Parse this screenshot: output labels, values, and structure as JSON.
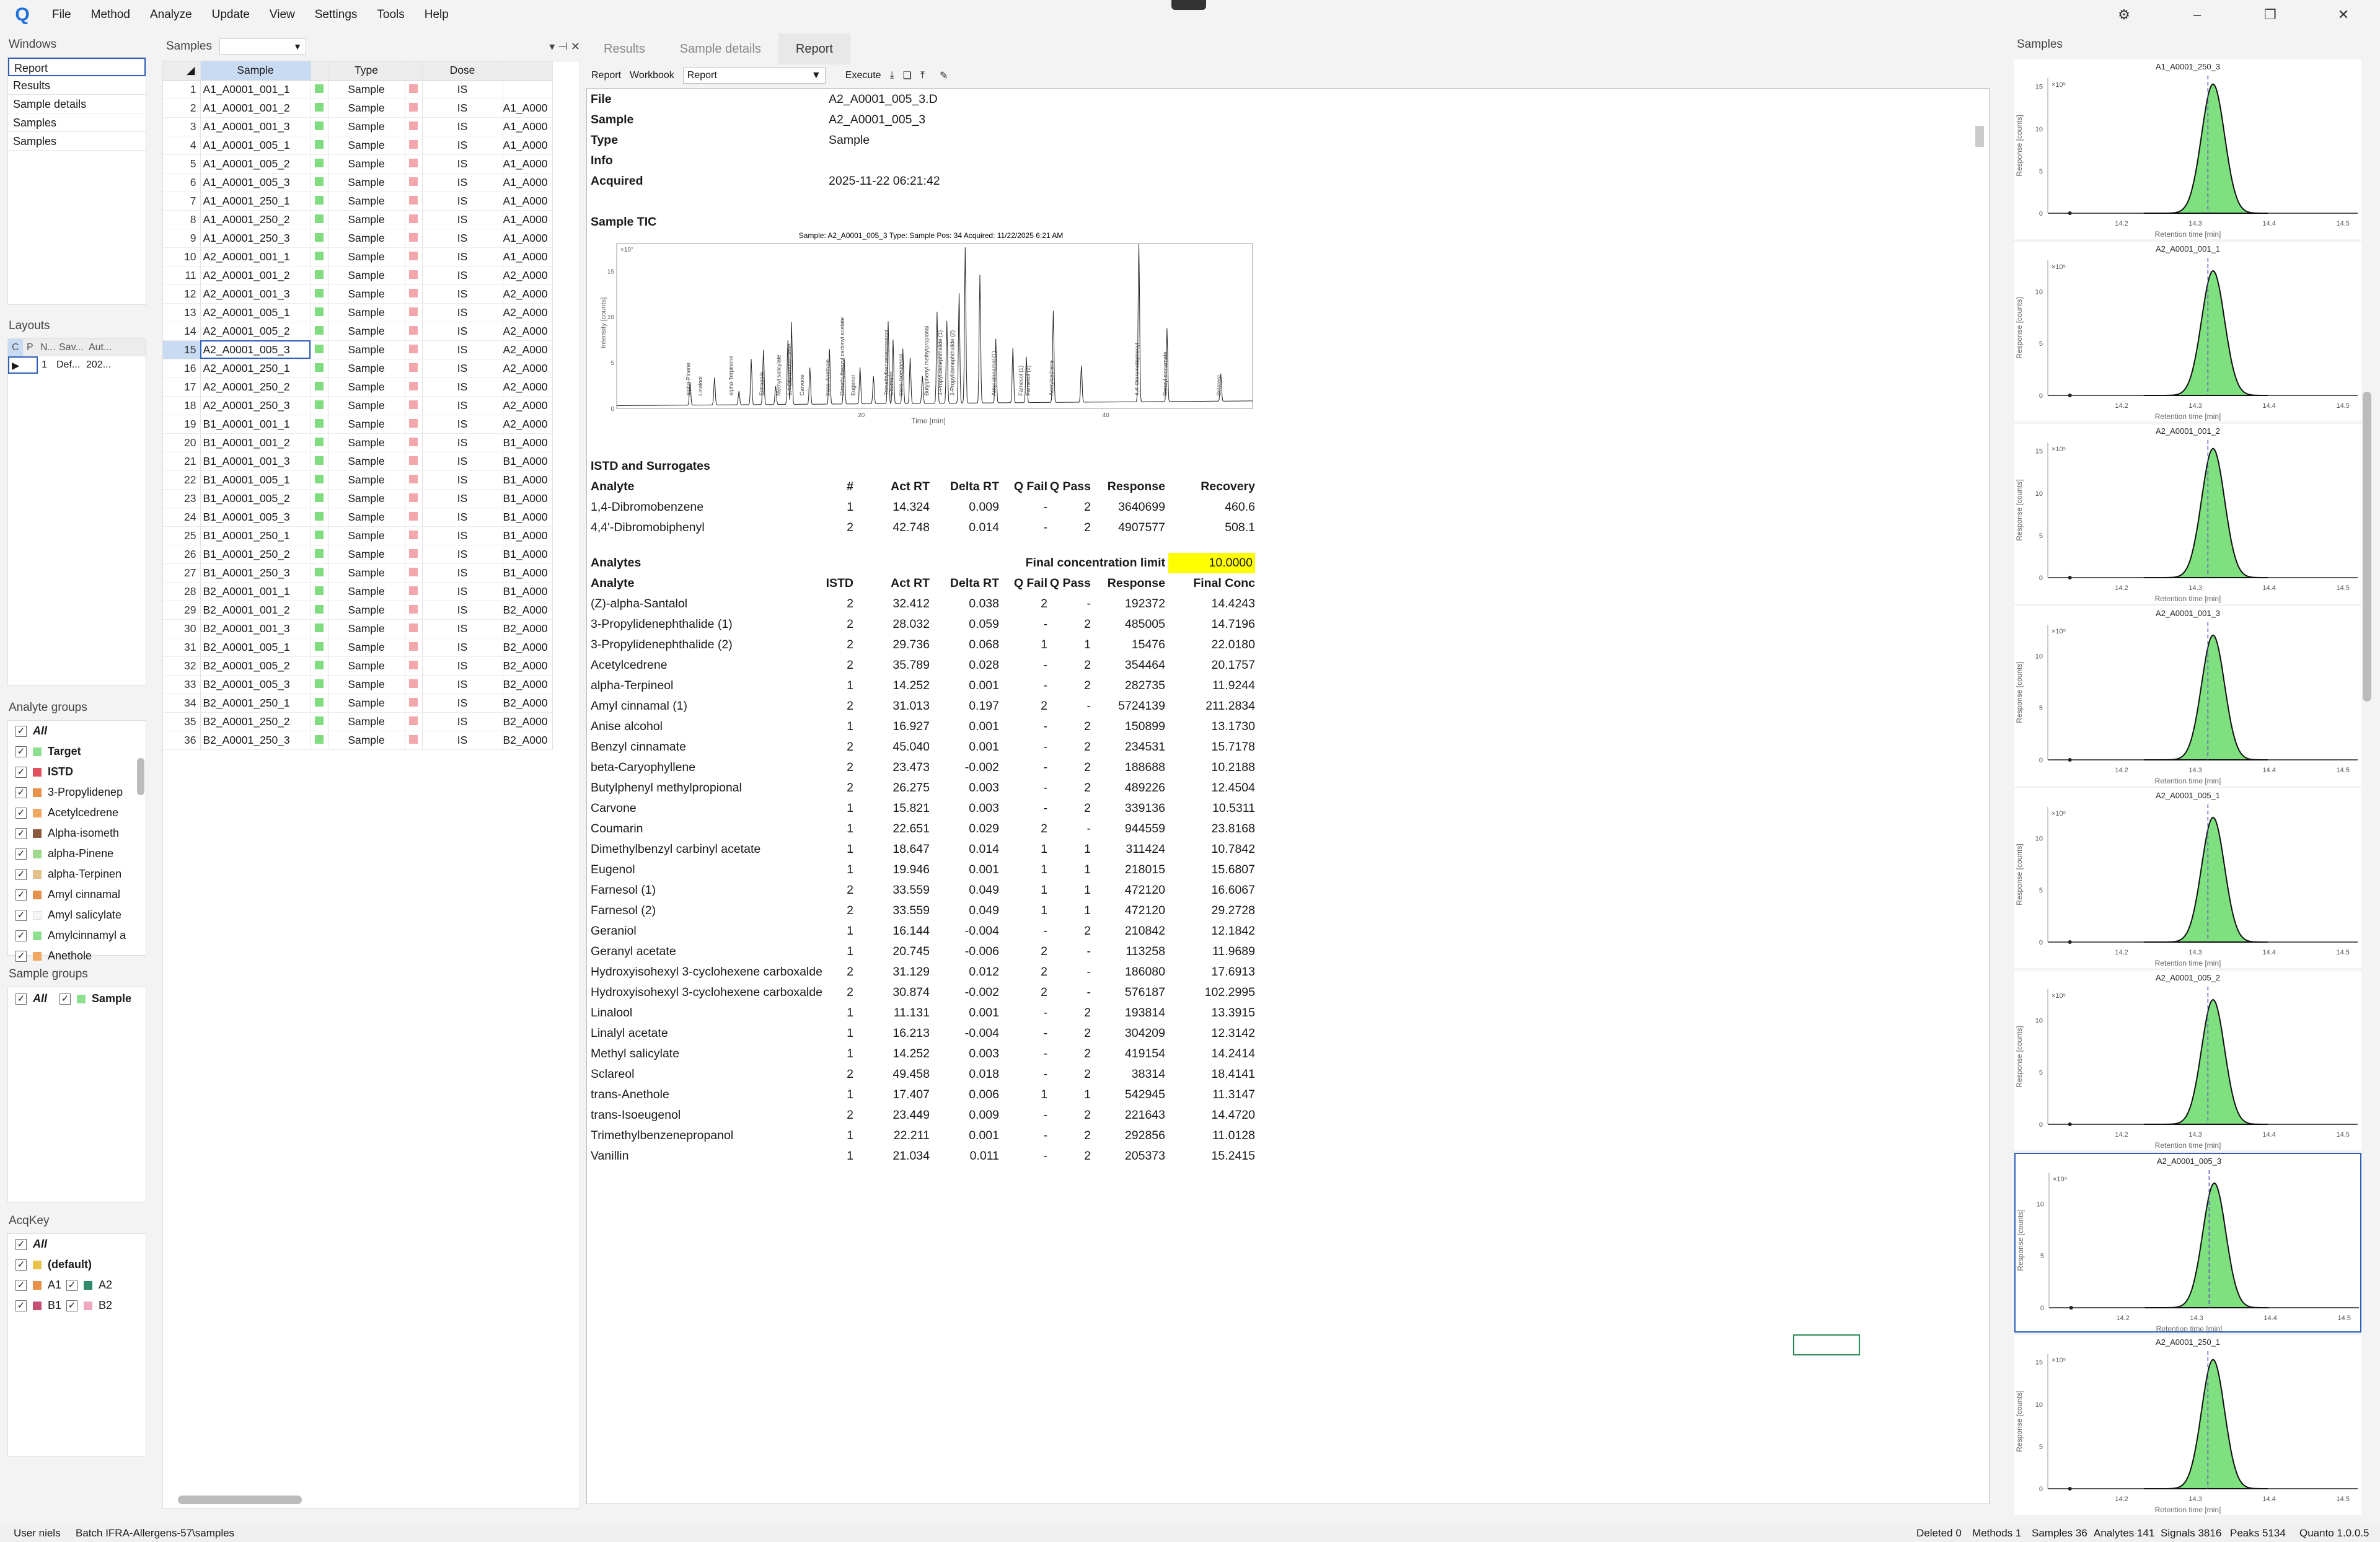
{
  "menu": [
    "File",
    "Method",
    "Analyze",
    "Update",
    "View",
    "Settings",
    "Tools",
    "Help"
  ],
  "windows": {
    "title": "Windows",
    "items": [
      "Report",
      "Results",
      "Sample details",
      "Samples",
      "Samples"
    ]
  },
  "layouts": {
    "title": "Layouts",
    "headers": [
      "C",
      "P",
      "N...",
      "Sav...",
      "Aut..."
    ],
    "row": [
      "1",
      "Def...",
      "202..."
    ]
  },
  "analyte_groups": {
    "title": "Analyte groups",
    "items": [
      {
        "label": "All",
        "color": "",
        "bold": true
      },
      {
        "label": "Target",
        "color": "#8de08d",
        "bold": true
      },
      {
        "label": "ISTD",
        "color": "#e0525d",
        "bold": true
      },
      {
        "label": "3-Propylidenep",
        "color": "#e8914a"
      },
      {
        "label": "Acetylcedrene",
        "color": "#f0a860"
      },
      {
        "label": "Alpha-isometh",
        "color": "#8b5a3c"
      },
      {
        "label": "alpha-Pinene",
        "color": "#9ed88f"
      },
      {
        "label": "alpha-Terpinen",
        "color": "#e3c18a"
      },
      {
        "label": "Amyl cinnamal",
        "color": "#e8914a"
      },
      {
        "label": "Amyl salicylate",
        "color": "#f5f5f5"
      },
      {
        "label": "Amylcinnamyl a",
        "color": "#8de08d"
      },
      {
        "label": "Anethole",
        "color": "#f0a860"
      }
    ]
  },
  "sample_groups": {
    "title": "Sample groups",
    "all": "All",
    "sample": "Sample"
  },
  "acqkey": {
    "title": "AcqKey",
    "all": "All",
    "default": "(default)",
    "a1": "A1",
    "a2": "A2",
    "b1": "B1",
    "b2": "B2"
  },
  "samples_panel": {
    "title": "Samples",
    "headers": [
      "Sample",
      "Type",
      "Dose"
    ],
    "rows": [
      {
        "n": "1",
        "name": "A1_A0001_001_1",
        "type": "Sample",
        "dose": "IS",
        "extra": ""
      },
      {
        "n": "2",
        "name": "A1_A0001_001_2",
        "type": "Sample",
        "dose": "IS",
        "extra": "A1_A000"
      },
      {
        "n": "3",
        "name": "A1_A0001_001_3",
        "type": "Sample",
        "dose": "IS",
        "extra": "A1_A000"
      },
      {
        "n": "4",
        "name": "A1_A0001_005_1",
        "type": "Sample",
        "dose": "IS",
        "extra": "A1_A000"
      },
      {
        "n": "5",
        "name": "A1_A0001_005_2",
        "type": "Sample",
        "dose": "IS",
        "extra": "A1_A000"
      },
      {
        "n": "6",
        "name": "A1_A0001_005_3",
        "type": "Sample",
        "dose": "IS",
        "extra": "A1_A000"
      },
      {
        "n": "7",
        "name": "A1_A0001_250_1",
        "type": "Sample",
        "dose": "IS",
        "extra": "A1_A000"
      },
      {
        "n": "8",
        "name": "A1_A0001_250_2",
        "type": "Sample",
        "dose": "IS",
        "extra": "A1_A000"
      },
      {
        "n": "9",
        "name": "A1_A0001_250_3",
        "type": "Sample",
        "dose": "IS",
        "extra": "A1_A000"
      },
      {
        "n": "10",
        "name": "A2_A0001_001_1",
        "type": "Sample",
        "dose": "IS",
        "extra": "A1_A000"
      },
      {
        "n": "11",
        "name": "A2_A0001_001_2",
        "type": "Sample",
        "dose": "IS",
        "extra": "A2_A000"
      },
      {
        "n": "12",
        "name": "A2_A0001_001_3",
        "type": "Sample",
        "dose": "IS",
        "extra": "A2_A000"
      },
      {
        "n": "13",
        "name": "A2_A0001_005_1",
        "type": "Sample",
        "dose": "IS",
        "extra": "A2_A000"
      },
      {
        "n": "14",
        "name": "A2_A0001_005_2",
        "type": "Sample",
        "dose": "IS",
        "extra": "A2_A000"
      },
      {
        "n": "15",
        "name": "A2_A0001_005_3",
        "type": "Sample",
        "dose": "IS",
        "extra": "A2_A000"
      },
      {
        "n": "16",
        "name": "A2_A0001_250_1",
        "type": "Sample",
        "dose": "IS",
        "extra": "A2_A000"
      },
      {
        "n": "17",
        "name": "A2_A0001_250_2",
        "type": "Sample",
        "dose": "IS",
        "extra": "A2_A000"
      },
      {
        "n": "18",
        "name": "A2_A0001_250_3",
        "type": "Sample",
        "dose": "IS",
        "extra": "A2_A000"
      },
      {
        "n": "19",
        "name": "B1_A0001_001_1",
        "type": "Sample",
        "dose": "IS",
        "extra": "A2_A000"
      },
      {
        "n": "20",
        "name": "B1_A0001_001_2",
        "type": "Sample",
        "dose": "IS",
        "extra": "B1_A000"
      },
      {
        "n": "21",
        "name": "B1_A0001_001_3",
        "type": "Sample",
        "dose": "IS",
        "extra": "B1_A000"
      },
      {
        "n": "22",
        "name": "B1_A0001_005_1",
        "type": "Sample",
        "dose": "IS",
        "extra": "B1_A000"
      },
      {
        "n": "23",
        "name": "B1_A0001_005_2",
        "type": "Sample",
        "dose": "IS",
        "extra": "B1_A000"
      },
      {
        "n": "24",
        "name": "B1_A0001_005_3",
        "type": "Sample",
        "dose": "IS",
        "extra": "B1_A000"
      },
      {
        "n": "25",
        "name": "B1_A0001_250_1",
        "type": "Sample",
        "dose": "IS",
        "extra": "B1_A000"
      },
      {
        "n": "26",
        "name": "B1_A0001_250_2",
        "type": "Sample",
        "dose": "IS",
        "extra": "B1_A000"
      },
      {
        "n": "27",
        "name": "B1_A0001_250_3",
        "type": "Sample",
        "dose": "IS",
        "extra": "B1_A000"
      },
      {
        "n": "28",
        "name": "B2_A0001_001_1",
        "type": "Sample",
        "dose": "IS",
        "extra": "B1_A000"
      },
      {
        "n": "29",
        "name": "B2_A0001_001_2",
        "type": "Sample",
        "dose": "IS",
        "extra": "B2_A000"
      },
      {
        "n": "30",
        "name": "B2_A0001_001_3",
        "type": "Sample",
        "dose": "IS",
        "extra": "B2_A000"
      },
      {
        "n": "31",
        "name": "B2_A0001_005_1",
        "type": "Sample",
        "dose": "IS",
        "extra": "B2_A000"
      },
      {
        "n": "32",
        "name": "B2_A0001_005_2",
        "type": "Sample",
        "dose": "IS",
        "extra": "B2_A000"
      },
      {
        "n": "33",
        "name": "B2_A0001_005_3",
        "type": "Sample",
        "dose": "IS",
        "extra": "B2_A000"
      },
      {
        "n": "34",
        "name": "B2_A0001_250_1",
        "type": "Sample",
        "dose": "IS",
        "extra": "B2_A000"
      },
      {
        "n": "35",
        "name": "B2_A0001_250_2",
        "type": "Sample",
        "dose": "IS",
        "extra": "B2_A000"
      },
      {
        "n": "36",
        "name": "B2_A0001_250_3",
        "type": "Sample",
        "dose": "IS",
        "extra": "B2_A000"
      }
    ]
  },
  "tabs": [
    "Results",
    "Sample details",
    "Report"
  ],
  "toolbar": {
    "report": "Report",
    "workbook": "Workbook",
    "select": "Report",
    "execute": "Execute"
  },
  "report": {
    "file_label": "File",
    "file": "A2_A0001_005_3.D",
    "sample_label": "Sample",
    "sample": "A2_A0001_005_3",
    "type_label": "Type",
    "type": "Sample",
    "info_label": "Info",
    "acq_label": "Acquired",
    "acquired": "2025-11-22 06:21:42",
    "tic_title": "Sample TIC",
    "tic_header": "Sample: A2_A0001_005_3 Type: Sample Pos: 34 Acquired: 11/22/2025 6:21 AM",
    "tic_ylabel": "Intensity [counts]",
    "tic_xlabel": "Time [min]",
    "tic_exp": "×10⁷",
    "tic_yticks": [
      "15",
      "10",
      "5",
      "0"
    ],
    "tic_xticks": [
      "20",
      "40"
    ],
    "tic_peaks": [
      "alpha-Pinene",
      "Linalool",
      "alpha-Terpinene",
      "Estragole",
      "Methyl salicylate",
      "1,4-Dibromobenzene",
      "Carvone",
      "trans-Anethole",
      "Dimethylbenzyl carbinyl acetate",
      "Eugenol",
      "Trimethylbenzenepropanol",
      "Coumarin",
      "trans-Isoeugenol",
      "Butylphenyl methylpropional",
      "3-Propylidenephthalide (1)",
      "3-Propylidenephthalide (2)",
      "Amyl cinnamal (1)",
      "Farnesol (1)",
      "Farnesol (2)",
      "Acetylcedrene",
      "4,4'-Dibromobiphenyl",
      "Benzyl cinnamate",
      "Sclareol"
    ],
    "istd_title": "ISTD and Surrogates",
    "istd_headers": [
      "Analyte",
      "#",
      "Act RT",
      "Delta RT",
      "Q Fail",
      "Q Pass",
      "Response",
      "Recovery"
    ],
    "istd_rows": [
      [
        "1,4-Dibromobenzene",
        "1",
        "14.324",
        "0.009",
        "-",
        "2",
        "3640699",
        "460.6"
      ],
      [
        "4,4'-Dibromobiphenyl",
        "2",
        "42.748",
        "0.014",
        "-",
        "2",
        "4907577",
        "508.1"
      ]
    ],
    "analytes_title": "Analytes",
    "fcl_label": "Final concentration limit",
    "fcl_value": "10.0000",
    "an_headers": [
      "Analyte",
      "ISTD",
      "Act RT",
      "Delta RT",
      "Q Fail",
      "Q Pass",
      "Response",
      "Final Conc"
    ],
    "an_rows": [
      [
        "(Z)-alpha-Santalol",
        "2",
        "32.412",
        "0.038",
        "2",
        "-",
        "192372",
        "14.4243"
      ],
      [
        "3-Propylidenephthalide (1)",
        "2",
        "28.032",
        "0.059",
        "-",
        "2",
        "485005",
        "14.7196"
      ],
      [
        "3-Propylidenephthalide (2)",
        "2",
        "29.736",
        "0.068",
        "1",
        "1",
        "15476",
        "22.0180"
      ],
      [
        "Acetylcedrene",
        "2",
        "35.789",
        "0.028",
        "-",
        "2",
        "354464",
        "20.1757"
      ],
      [
        "alpha-Terpineol",
        "1",
        "14.252",
        "0.001",
        "-",
        "2",
        "282735",
        "11.9244"
      ],
      [
        "Amyl cinnamal (1)",
        "2",
        "31.013",
        "0.197",
        "2",
        "-",
        "5724139",
        "211.2834"
      ],
      [
        "Anise alcohol",
        "1",
        "16.927",
        "0.001",
        "-",
        "2",
        "150899",
        "13.1730"
      ],
      [
        "Benzyl cinnamate",
        "2",
        "45.040",
        "0.001",
        "-",
        "2",
        "234531",
        "15.7178"
      ],
      [
        "beta-Caryophyllene",
        "2",
        "23.473",
        "-0.002",
        "-",
        "2",
        "188688",
        "10.2188"
      ],
      [
        "Butylphenyl methylpropional",
        "2",
        "26.275",
        "0.003",
        "-",
        "2",
        "489226",
        "12.4504"
      ],
      [
        "Carvone",
        "1",
        "15.821",
        "0.003",
        "-",
        "2",
        "339136",
        "10.5311"
      ],
      [
        "Coumarin",
        "1",
        "22.651",
        "0.029",
        "2",
        "-",
        "944559",
        "23.8168"
      ],
      [
        "Dimethylbenzyl carbinyl acetate",
        "1",
        "18.647",
        "0.014",
        "1",
        "1",
        "311424",
        "10.7842"
      ],
      [
        "Eugenol",
        "1",
        "19.946",
        "0.001",
        "1",
        "1",
        "218015",
        "15.6807"
      ],
      [
        "Farnesol (1)",
        "2",
        "33.559",
        "0.049",
        "1",
        "1",
        "472120",
        "16.6067"
      ],
      [
        "Farnesol (2)",
        "2",
        "33.559",
        "0.049",
        "1",
        "1",
        "472120",
        "29.2728"
      ],
      [
        "Geraniol",
        "1",
        "16.144",
        "-0.004",
        "-",
        "2",
        "210842",
        "12.1842"
      ],
      [
        "Geranyl acetate",
        "1",
        "20.745",
        "-0.006",
        "2",
        "-",
        "113258",
        "11.9689"
      ],
      [
        "Hydroxyisohexyl 3-cyclohexene carboxalde",
        "2",
        "31.129",
        "0.012",
        "2",
        "-",
        "186080",
        "17.6913"
      ],
      [
        "Hydroxyisohexyl 3-cyclohexene carboxalde",
        "2",
        "30.874",
        "-0.002",
        "2",
        "-",
        "576187",
        "102.2995"
      ],
      [
        "Linalool",
        "1",
        "11.131",
        "0.001",
        "-",
        "2",
        "193814",
        "13.3915"
      ],
      [
        "Linalyl acetate",
        "1",
        "16.213",
        "-0.004",
        "-",
        "2",
        "304209",
        "12.3142"
      ],
      [
        "Methyl salicylate",
        "1",
        "14.252",
        "0.003",
        "-",
        "2",
        "419154",
        "14.2414"
      ],
      [
        "Sclareol",
        "2",
        "49.458",
        "0.018",
        "-",
        "2",
        "38314",
        "18.4141"
      ],
      [
        "trans-Anethole",
        "1",
        "17.407",
        "0.006",
        "1",
        "1",
        "542945",
        "11.3147"
      ],
      [
        "trans-Isoeugenol",
        "2",
        "23.449",
        "0.009",
        "-",
        "2",
        "221643",
        "14.4720"
      ],
      [
        "Trimethylbenzenepropanol",
        "1",
        "22.211",
        "0.001",
        "-",
        "2",
        "292856",
        "11.0128"
      ],
      [
        "Vanillin",
        "1",
        "21.034",
        "0.011",
        "-",
        "2",
        "205373",
        "15.2415"
      ]
    ]
  },
  "right_panel": {
    "title": "Samples",
    "exp": "×10⁵",
    "ylabel": "Response [counts]",
    "xlabel": "Retention time [min]",
    "xticks": [
      "14.2",
      "14.3",
      "14.4",
      "14.5"
    ],
    "thumbs": [
      {
        "title": "A1_A0001_250_3",
        "yticks": [
          "15",
          "10",
          "5",
          "0"
        ]
      },
      {
        "title": "A2_A0001_001_1",
        "yticks": [
          "10",
          "5",
          "0"
        ]
      },
      {
        "title": "A2_A0001_001_2",
        "yticks": [
          "15",
          "10",
          "5",
          "0"
        ]
      },
      {
        "title": "A2_A0001_001_3",
        "yticks": [
          "10",
          "5",
          "0"
        ]
      },
      {
        "title": "A2_A0001_005_1",
        "yticks": [
          "10",
          "5",
          "0"
        ]
      },
      {
        "title": "A2_A0001_005_2",
        "yticks": [
          "10",
          "5",
          "0"
        ]
      },
      {
        "title": "A2_A0001_005_3",
        "yticks": [
          "10",
          "5",
          "0"
        ]
      },
      {
        "title": "A2_A0001_250_1",
        "yticks": [
          "15",
          "10",
          "5",
          "0"
        ]
      }
    ]
  },
  "status": {
    "user": "User niels",
    "batch": "Batch IFRA-Allergens-57\\samples",
    "deleted": "Deleted 0",
    "methods": "Methods 1",
    "samples": "Samples 36",
    "analytes": "Analytes 141",
    "signals": "Signals 3816",
    "peaks": "Peaks 5134",
    "version": "Quanto 1.0.0.5"
  }
}
